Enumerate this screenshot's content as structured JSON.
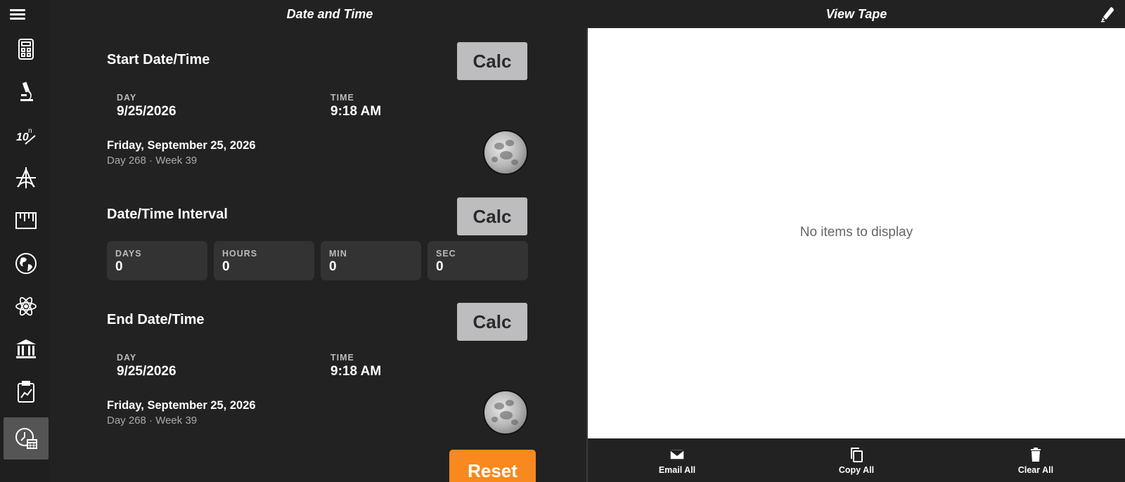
{
  "header": {
    "left_title": "Date and Time",
    "right_title": "View Tape"
  },
  "sidebar": {
    "items": [
      {
        "icon": "calculator-icon"
      },
      {
        "icon": "microscope-icon"
      },
      {
        "icon": "exponent-icon"
      },
      {
        "icon": "geometry-icon"
      },
      {
        "icon": "ruler-icon"
      },
      {
        "icon": "globe-icon"
      },
      {
        "icon": "atom-icon"
      },
      {
        "icon": "bank-icon"
      },
      {
        "icon": "clipboard-chart-icon"
      },
      {
        "icon": "clock-calendar-icon",
        "active": true
      }
    ]
  },
  "start": {
    "title": "Start Date/Time",
    "calc_label": "Calc",
    "day_label": "DAY",
    "day_value": "9/25/2026",
    "time_label": "TIME",
    "time_value": "9:18 AM",
    "long_date": "Friday, September 25, 2026",
    "sub_date": "Day 268 · Week 39"
  },
  "interval": {
    "title": "Date/Time Interval",
    "calc_label": "Calc",
    "fields": [
      {
        "label": "DAYS",
        "value": "0"
      },
      {
        "label": "HOURS",
        "value": "0"
      },
      {
        "label": "MIN",
        "value": "0"
      },
      {
        "label": "SEC",
        "value": "0"
      }
    ]
  },
  "end": {
    "title": "End Date/Time",
    "calc_label": "Calc",
    "day_label": "DAY",
    "day_value": "9/25/2026",
    "time_label": "TIME",
    "time_value": "9:18 AM",
    "long_date": "Friday, September 25, 2026",
    "sub_date": "Day 268 · Week 39"
  },
  "reset_label": "Reset",
  "tape": {
    "empty_text": "No items to display",
    "actions": [
      {
        "label": "Email All",
        "icon": "envelope-icon"
      },
      {
        "label": "Copy All",
        "icon": "copy-icon"
      },
      {
        "label": "Clear All",
        "icon": "trash-icon"
      }
    ]
  },
  "colors": {
    "accent": "#f7891e",
    "calc_button": "#bdbdbf",
    "background": "#222222"
  }
}
